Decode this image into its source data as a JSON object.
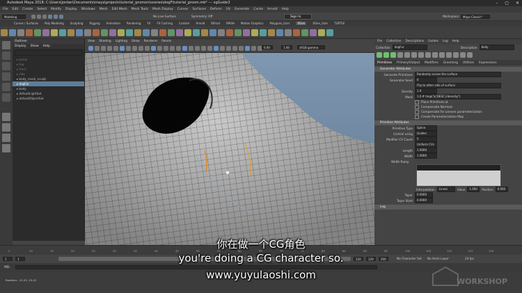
{
  "window": {
    "title": "Autodesk Maya 2018: C:\\Users\\jordan\\Documents\\maya\\projects\\tutorial_gnomon\\scenes\\dogF\\tutorial_groom.mb* --- xgGuide3"
  },
  "menubar": [
    "File",
    "Edit",
    "Create",
    "Select",
    "Modify",
    "Display",
    "Windows",
    "Mesh",
    "Edit Mesh",
    "Mesh Tools",
    "Mesh Display",
    "Curves",
    "Surfaces",
    "Deform",
    "UV",
    "Generate",
    "Cache",
    "Arnold",
    "Help"
  ],
  "status": {
    "mode": "Modeling",
    "live_surface": "No Live Surface",
    "symmetry": "Symmetry: Off",
    "sign_in": "Sign In",
    "workspace_label": "Workspace:",
    "workspace": "Maya Classic*"
  },
  "shelf_tabs": [
    "Curves / Surfaces",
    "Poly Modeling",
    "Sculpting",
    "Rigging",
    "Animation",
    "Rendering",
    "FX",
    "FX Caching",
    "Custom",
    "Arnold",
    "Bifrost",
    "MASH",
    "Motion Graphics",
    "Polygons_User",
    "XGen",
    "XGen_User",
    "TURTLE"
  ],
  "outliner": {
    "title": "Outliner",
    "menus": [
      "Display",
      "Show",
      "Help"
    ],
    "items": [
      {
        "label": "persp",
        "style": "dim"
      },
      {
        "label": "top",
        "style": "dim"
      },
      {
        "label": "front",
        "style": "dim"
      },
      {
        "label": "side",
        "style": "dim"
      },
      {
        "label": "body_mesh_sculpt",
        "style": ""
      },
      {
        "label": "dogFur",
        "style": "sel"
      },
      {
        "label": "body",
        "style": ""
      },
      {
        "label": "defaultLightSet",
        "style": ""
      },
      {
        "label": "defaultObjectSet",
        "style": ""
      }
    ]
  },
  "viewport": {
    "menus": [
      "View",
      "Shading",
      "Lighting",
      "Show",
      "Renderer",
      "Panels"
    ],
    "exposure": "0.00",
    "gamma": "1.00",
    "color_space": "sRGB gamma"
  },
  "xgen": {
    "menus": [
      "File",
      "Collection",
      "Descriptions",
      "Guides",
      "Log",
      "Help"
    ],
    "collection_label": "Collection",
    "collection": "dogFur",
    "description_label": "Description",
    "description": "body",
    "tabs": [
      "Primitives",
      "Primary/Output",
      "Modifiers",
      "Grooming",
      "Utilities",
      "Expressions"
    ],
    "sections": {
      "generator": "Generator Attributes",
      "primitive": "Primitive Attributes"
    },
    "gen_fields": [
      {
        "label": "Generate Primitives",
        "value": "Randomly across the surface"
      },
      {
        "label": "Generator Seed",
        "value": "0"
      },
      {
        "label": "",
        "value": "Flip to other side of surface"
      },
      {
        "label": "Density",
        "value": "1.0"
      },
      {
        "label": "Mask",
        "value": "1.0 # map('${DESC}/density/')"
      }
    ],
    "checks": [
      "Place Primitives at",
      "Compensate Normals",
      "Compensate for uneven parameterization",
      "Create Parameterization Map"
    ],
    "prim_fields": [
      {
        "label": "Primitive Type",
        "value": "Spline"
      },
      {
        "label": "Control using",
        "value": "Guides"
      },
      {
        "label": "Modifier CV Count",
        "value": "5"
      },
      {
        "label": "",
        "value": "Uniform CVs"
      },
      {
        "label": "Length",
        "value": "1.0000"
      },
      {
        "label": "Width",
        "value": "1.0000"
      }
    ],
    "width_ramp": {
      "label": "Width Ramp",
      "interp_label": "Interpolation",
      "interp": "Linear",
      "value_label": "Value",
      "value": "1.000",
      "pos_label": "Position",
      "pos": "0.000"
    },
    "taper": {
      "label": "Taper",
      "value": "0.0000"
    },
    "taper_start": {
      "label": "Taper Start",
      "value": "0.0000"
    },
    "log": "Log"
  },
  "timeline": {
    "ticks": [
      "5",
      "10",
      "15",
      "20",
      "25",
      "30",
      "35",
      "40",
      "45",
      "50",
      "55",
      "60",
      "65",
      "70",
      "75",
      "80",
      "85",
      "90",
      "95",
      "100",
      "105",
      "110",
      "115",
      "120"
    ],
    "start": "1",
    "end": "1",
    "range_end": "120",
    "anim_end": "120",
    "anim_end2": "200",
    "char_set": "No Character Set",
    "anim_layer": "No Anim Layer",
    "fps": "24 fps"
  },
  "command": {
    "mel": "MEL"
  },
  "help": {
    "text": "Rotation: -15.43  -15.43"
  },
  "subtitles": {
    "chinese": "你在做一个CG角色",
    "english": "you're doing a CG character so.",
    "site": "www.yuyulaoshi.com"
  },
  "watermark": {
    "text": "WORKSHOP"
  }
}
